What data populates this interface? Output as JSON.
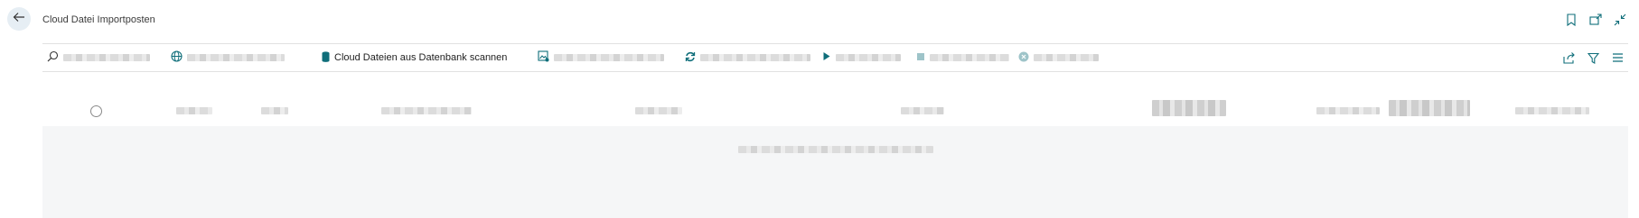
{
  "header": {
    "title": "Cloud Datei Importposten",
    "back_icon": "arrow-left-icon",
    "actions": [
      "bookmark-icon",
      "open-new-window-icon",
      "collapse-icon"
    ]
  },
  "actionbar": {
    "scan_label": "Cloud Dateien aus Datenbank scannen",
    "right_actions": [
      "share-icon",
      "filter-icon",
      "list-view-icon"
    ]
  },
  "colors": {
    "accent": "#0f6e7a",
    "back_bg": "#e6eef4",
    "grid_bg": "#f5f6f7"
  }
}
